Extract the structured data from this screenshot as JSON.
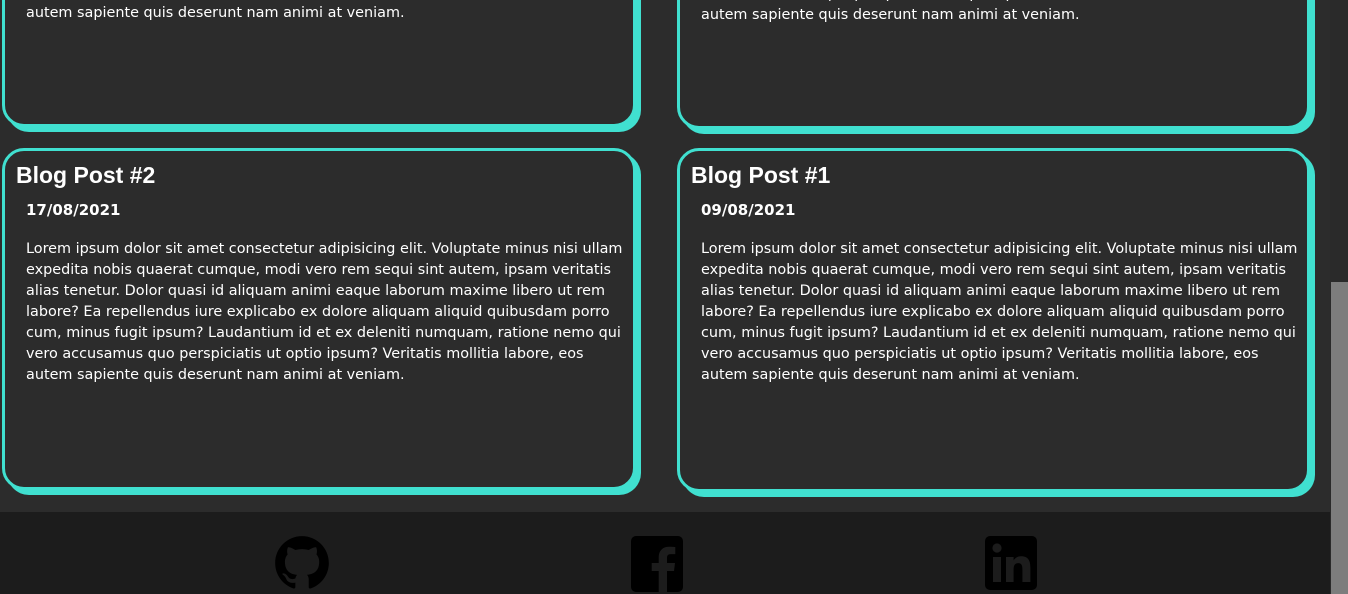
{
  "posts": {
    "top_left": {
      "body": "Lorem ipsum dolor sit amet consectetur adipisicing elit. Voluptate minus nisi ullam expedita nobis quaerat cumque, modi vero rem sequi sint autem, ipsam veritatis alias tenetur. Dolor quasi id aliquam animi eaque laborum maxime libero ut rem labore? Ea repellendus iure explicabo ex dolore aliquam aliquid quibusdam porro cum, minus fugit ipsum? Laudantium id et ex deleniti numquam, ratione nemo qui vero accusamus quo perspiciatis ut optio ipsum? Veritatis mollitia labore, eos autem sapiente quis deserunt nam animi at veniam."
    },
    "top_right": {
      "body": "Lorem ipsum dolor sit amet consectetur adipisicing elit. Voluptate minus nisi ullam expedita nobis quaerat cumque, modi vero rem sequi sint autem, ipsam veritatis alias tenetur. Dolor quasi id aliquam animi eaque laborum maxime libero ut rem labore? Ea repellendus iure explicabo ex dolore aliquam aliquid quibusdam porro cum, minus fugit ipsum? Laudantium id et ex deleniti numquam, ratione nemo qui vero accusamus quo perspiciatis ut optio ipsum? Veritatis mollitia labore, eos autem sapiente quis deserunt nam animi at veniam."
    },
    "post2": {
      "title": "Blog Post #2",
      "date": "17/08/2021",
      "body": "Lorem ipsum dolor sit amet consectetur adipisicing elit. Voluptate minus nisi ullam expedita nobis quaerat cumque, modi vero rem sequi sint autem, ipsam veritatis alias tenetur. Dolor quasi id aliquam animi eaque laborum maxime libero ut rem labore? Ea repellendus iure explicabo ex dolore aliquam aliquid quibusdam porro cum, minus fugit ipsum? Laudantium id et ex deleniti numquam, ratione nemo qui vero accusamus quo perspiciatis ut optio ipsum? Veritatis mollitia labore, eos autem sapiente quis deserunt nam animi at veniam."
    },
    "post1": {
      "title": "Blog Post #1",
      "date": "09/08/2021",
      "body": "Lorem ipsum dolor sit amet consectetur adipisicing elit. Voluptate minus nisi ullam expedita nobis quaerat cumque, modi vero rem sequi sint autem, ipsam veritatis alias tenetur. Dolor quasi id aliquam animi eaque laborum maxime libero ut rem labore? Ea repellendus iure explicabo ex dolore aliquam aliquid quibusdam porro cum, minus fugit ipsum? Laudantium id et ex deleniti numquam, ratione nemo qui vero accusamus quo perspiciatis ut optio ipsum? Veritatis mollitia labore, eos autem sapiente quis deserunt nam animi at veniam."
    }
  },
  "footer": {
    "icons": [
      "github-icon",
      "facebook-icon",
      "linkedin-icon"
    ]
  },
  "colors": {
    "accent": "#40e0d0",
    "background": "#2c2c2c",
    "footer": "#1c1c1c",
    "icon": "#000000",
    "text": "#ffffff"
  }
}
